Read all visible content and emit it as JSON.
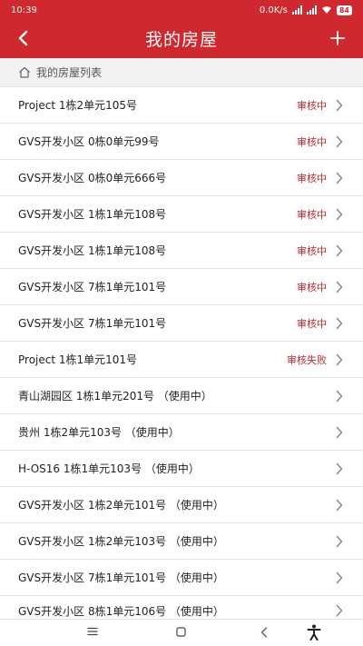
{
  "status_bar": {
    "time": "10:39",
    "net_speed": "0.0K/s",
    "battery": "84"
  },
  "header": {
    "title": "我的房屋"
  },
  "section": {
    "label": "我的房屋列表"
  },
  "houses": [
    {
      "name": "Project 1栋2单元105号",
      "status": "审核中"
    },
    {
      "name": "GVS开发小区 0栋0单元99号",
      "status": "审核中"
    },
    {
      "name": "GVS开发小区 0栋0单元666号",
      "status": "审核中"
    },
    {
      "name": "GVS开发小区 1栋1单元108号",
      "status": "审核中"
    },
    {
      "name": "GVS开发小区 1栋1单元108号",
      "status": "审核中"
    },
    {
      "name": "GVS开发小区 7栋1单元101号",
      "status": "审核中"
    },
    {
      "name": "GVS开发小区 7栋1单元101号",
      "status": "审核中"
    },
    {
      "name": "Project 1栋1单元101号",
      "status": "审核失败"
    },
    {
      "name": "青山湖园区 1栋1单元201号 （使用中）",
      "status": ""
    },
    {
      "name": "贵州 1栋2单元103号 （使用中）",
      "status": ""
    },
    {
      "name": "H-OS16 1栋1单元103号 （使用中）",
      "status": ""
    },
    {
      "name": "GVS开发小区 1栋2单元101号 （使用中）",
      "status": ""
    },
    {
      "name": "GVS开发小区 1栋2单元103号 （使用中）",
      "status": ""
    },
    {
      "name": "GVS开发小区 7栋1单元101号 （使用中）",
      "status": ""
    },
    {
      "name": "GVS开发小区 8栋1单元106号 （使用中）",
      "status": ""
    }
  ],
  "colors": {
    "header_bg": "#d0282f",
    "status_text": "#c0282c"
  }
}
